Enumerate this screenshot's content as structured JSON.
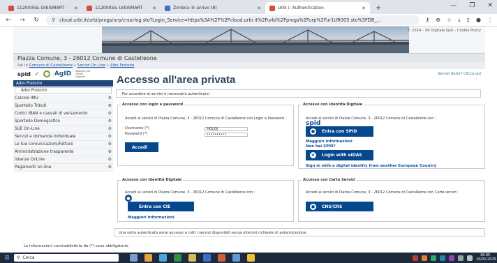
{
  "browser": {
    "tabs": [
      {
        "title": "1120005& UrbiSMART - CONT...",
        "color": "#d94a3a",
        "active": false
      },
      {
        "title": "1120005& UrbiSMART - Servizi",
        "color": "#d94a3a",
        "active": false
      },
      {
        "title": "Zimbra: In arrivo (8)",
        "color": "#3d72c9",
        "active": false
      },
      {
        "title": "Urbi i: Authentication",
        "color": "#d94a3a",
        "active": true
      }
    ],
    "new_tab": "+",
    "url": "cloud.urbi.it/urbi/progs/urp/crsurlog.sto?Login_Service=https%3A%2F%2Fcloud.urbi.it%2Furbi%2Fprogs%2Furp%2Fur1UR003.sto%3FDB_..."
  },
  "banner": {
    "copyright": "© 2024 – PA Digitale SpA – Cookie Policy"
  },
  "header": {
    "comune": "Piazza Comune, 3 - 26012 Comune di Castelleone",
    "breadcrumb_prefix": "Sei in",
    "breadcrumb": [
      "Comune di Castelleone",
      "Servizi On Line",
      "Albo Pretorio"
    ],
    "spid_label": "spid",
    "agid_label": "AgID",
    "agid_sub": "Agenzia per l'Italia Digitale",
    "help_link": "Servizi Aiuto? Clicca qui"
  },
  "sidebar": {
    "active": "Albo Pretorio",
    "sub": "Albo Pretorio",
    "items": [
      "Calcolo IMU",
      "Sportello Tributi",
      "Codici IBAN e causali di versamento",
      "Sportello Demografico",
      "SUE On-Line",
      "Servizi a domanda individuale",
      "Le tue comunicazioni/Fatture",
      "Amministrazione trasparente",
      "Istanze OnLine",
      "Pagamenti on-line"
    ]
  },
  "main": {
    "title": "Accesso all'area privata",
    "notice": "Per accedere ai servizi è necessario autenticarsi",
    "login": {
      "legend": "Accesso con login e password",
      "text": "Accedi ai servizi di Piazza Comune, 3 - 26012 Comune di Castelleone con Login e Password :",
      "username_label": "Username (*)",
      "username_value": "MOLISI",
      "password_label": "Password (*)",
      "password_value": "••••••••••",
      "submit": "Accedi"
    },
    "digital": {
      "legend": "Accesso con Identità Digitale",
      "text": "Accedi ai servizi di Piazza Comune, 3 - 26012 Comune di Castelleone con :",
      "spid_word": "spid",
      "spid_button": "Entra con SPID",
      "more_info": "Maggiori informazioni",
      "no_spid": "Non hai SPID?",
      "eidas_button": "Login with eIDAS",
      "eu_link": "Sign in with a digital identity from another European Country"
    },
    "cie": {
      "legend": "Accesso con Identità Digitale",
      "text": "Accedi ai servizi di Piazza Comune, 3 - 26012 Comune di Castelleone con :",
      "button": "Entra con CIE",
      "more_info": "Maggiori informazioni"
    },
    "cns": {
      "legend": "Accesso con Carta Servizi",
      "text": "Accedi ai servizi di Piazza Comune, 3 - 26012 Comune di Castelleone con Carta servizi :",
      "button": "CNS/CRS"
    },
    "footer_note": "Una volta autenticato avrai accesso a tutti i servizi disponibili senza ulteriori richieste di autenticazione",
    "obligatory": "Le informazioni contraddistinte da (*) sono obbligatorie."
  },
  "taskbar": {
    "search": "Cerca",
    "time": "16:05",
    "date": "10/01/2025"
  },
  "colors": {
    "brand_blue": "#06488e",
    "sidebar_active": "#21467b"
  }
}
